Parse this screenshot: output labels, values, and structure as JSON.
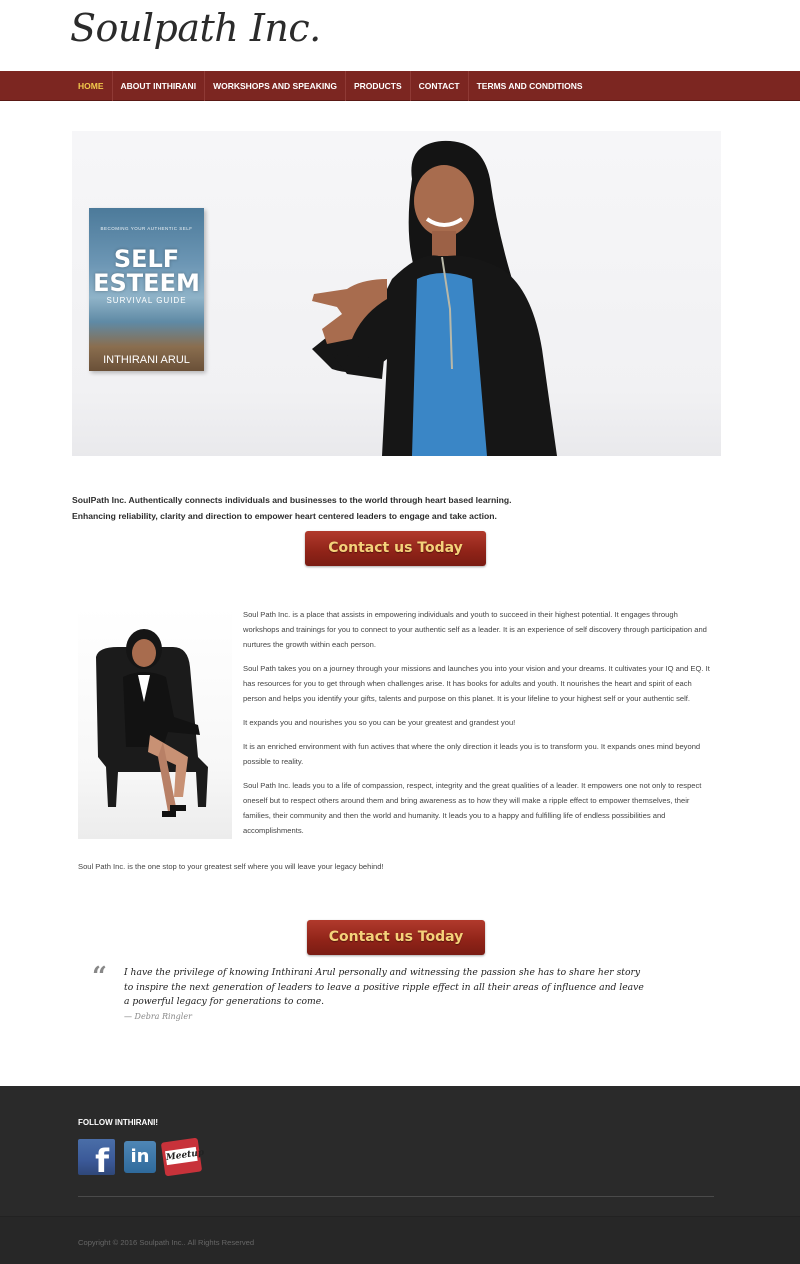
{
  "site": {
    "logo": "Soulpath Inc."
  },
  "nav": {
    "items": [
      {
        "label": "HOME",
        "active": true
      },
      {
        "label": "ABOUT INTHIRANI",
        "active": false
      },
      {
        "label": "WORKSHOPS AND SPEAKING",
        "active": false
      },
      {
        "label": "PRODUCTS",
        "active": false
      },
      {
        "label": "CONTACT",
        "active": false
      },
      {
        "label": "TERMS AND CONDITIONS",
        "active": false
      }
    ]
  },
  "hero": {
    "book": {
      "tagline": "BECOMING YOUR AUTHENTIC SELF",
      "title": "SELF ESTEEM",
      "subtitle": "SURVIVAL GUIDE",
      "author": "INTHIRANI ARUL"
    }
  },
  "intro": {
    "line1": "SoulPath Inc. Authentically connects individuals and businesses to the world through heart based learning.",
    "line2": "Enhancing reliability, clarity and direction to empower heart centered leaders to engage and take action."
  },
  "cta": {
    "label": "Contact us Today"
  },
  "about": {
    "paragraphs": [
      "Soul Path Inc. is a place that assists in empowering individuals and youth to succeed in their highest potential. It engages through workshops and trainings for you to connect to your authentic self as a leader. It is an experience of self discovery through participation and nurtures the growth within each person.",
      "Soul Path takes you on a journey through your missions and launches you into your vision and your dreams. It cultivates your IQ and EQ. It has resources for you to get through when challenges arise. It has books for adults and youth. It nourishes the heart and spirit of each person and helps you identify your gifts, talents and purpose on this planet. It is your lifeline to your highest self or your authentic self.",
      "It expands you and nourishes you so you can be your greatest and grandest you!",
      "It is an enriched environment with fun actives that where the only direction it leads you is to transform you. It expands ones mind beyond possible to reality.",
      "Soul Path Inc. leads you to a life of compassion, respect, integrity and the great qualities of a leader. It empowers one not only to respect oneself but to respect others around them and bring awareness as to how they will make a ripple effect to empower themselves, their families, their community and then the world and humanity. It leads you to a happy and fulfilling life of endless possibilities and accomplishments."
    ],
    "closing": "Soul Path Inc. is the one stop to your greatest self where you will leave your legacy behind!"
  },
  "testimonial": {
    "mark": "“",
    "text": "I have the privilege of knowing Inthirani Arul personally and witnessing the passion she has to share her story to inspire the next generation of leaders to leave a positive ripple effect in all their areas of influence and leave a powerful legacy for generations to come.",
    "author": "— Debra Ringler"
  },
  "footer": {
    "follow_heading": "FOLLOW INTHIRANI!",
    "social": [
      {
        "name": "facebook",
        "glyph": "f"
      },
      {
        "name": "linkedin",
        "glyph": "in"
      },
      {
        "name": "meetup",
        "glyph": "Meetup"
      }
    ],
    "copyright": "Copyright © 2016 Soulpath Inc.. All Rights Reserved"
  },
  "colors": {
    "nav_bg": "#7c2621",
    "nav_active": "#f2c94c",
    "cta_bg": "#8f2318",
    "cta_text": "#f5d27a",
    "footer_bg": "#2a2a2a"
  }
}
